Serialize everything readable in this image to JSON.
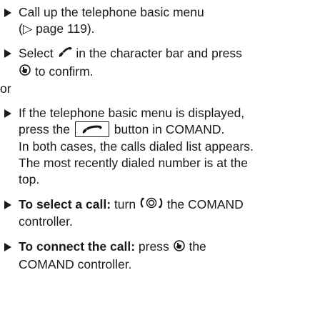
{
  "steps": {
    "s1_line1": "Call up the telephone basic menu",
    "s1_line2": "(▷ page 119).",
    "s2_a": "Select",
    "s2_b": "in the character bar and press",
    "s2_c": "to confirm.",
    "or": "or",
    "s3_line1": "If the telephone basic menu is displayed,",
    "s3_a": "press the",
    "s3_b": "button in COMAND.",
    "p1": "In both cases, the calls dialed list appears.",
    "p2": "The most recently dialed number is at the",
    "p3": "top.",
    "s4_bold": "To select a call:",
    "s4_a": "turn",
    "s4_b": "the COMAND",
    "s4_line2": "controller.",
    "s5_bold": "To connect the call:",
    "s5_a": "press",
    "s5_b": "the",
    "s5_line2": "COMAND controller."
  },
  "icons": {
    "phone": "phone-handset-icon",
    "press": "press-controller-icon",
    "call_button": "call-button-icon",
    "turn": "turn-controller-icon"
  }
}
